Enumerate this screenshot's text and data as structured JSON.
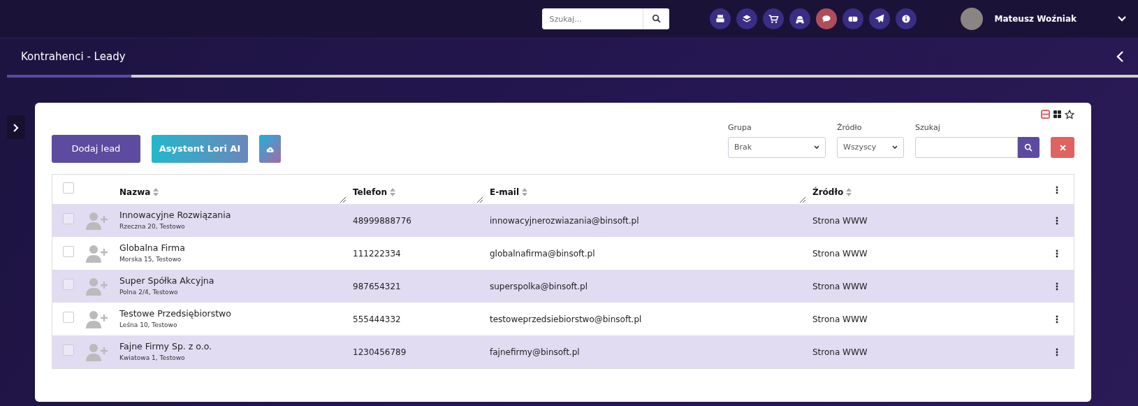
{
  "topbar": {
    "search": {
      "placeholder": "Szukaj..."
    },
    "icons": [
      {
        "kind": "register",
        "highlighted": false
      },
      {
        "kind": "layers",
        "highlighted": false
      },
      {
        "kind": "cart",
        "highlighted": false
      },
      {
        "kind": "robot",
        "highlighted": false
      },
      {
        "kind": "chat",
        "highlighted": true
      },
      {
        "kind": "mailbox",
        "highlighted": false
      },
      {
        "kind": "plane",
        "highlighted": false
      },
      {
        "kind": "info",
        "highlighted": false
      }
    ],
    "user": {
      "name": "Mateusz Woźniak"
    }
  },
  "page": {
    "title": "Kontrahenci - Leady",
    "progress": {
      "level": 0.11
    }
  },
  "toolbar": {
    "buttons": [
      {
        "kind": "primary",
        "label": "Dodaj lead"
      },
      {
        "kind": "gradient",
        "label": "Asystent Lori AI"
      },
      {
        "kind": "cloud"
      }
    ],
    "view_toggles": [
      {
        "kind": "list",
        "selected": true
      },
      {
        "kind": "grid",
        "selected": false
      },
      {
        "kind": "star",
        "selected": false
      }
    ],
    "filters": [
      {
        "kind": "select",
        "label": "Grupa",
        "value": "Brak"
      },
      {
        "kind": "select",
        "label": "Źródło",
        "value": "Wszyscy"
      },
      {
        "kind": "search",
        "label": "Szukaj"
      }
    ]
  },
  "table": {
    "header_checked": false,
    "columns": [
      "Nazwa",
      "Telefon",
      "E-mail",
      "Źródło"
    ],
    "rows": [
      {
        "checked": false,
        "name": "Innowacyjne Rozwiązania",
        "address": "Rzeczna 20, Testowo",
        "phone": "48999888776",
        "email": "innowacyjnerozwiazania@binsoft.pl",
        "source": "Strona WWW"
      },
      {
        "checked": false,
        "name": "Globalna Firma",
        "address": "Morska 15, Testowo",
        "phone": "111222334",
        "email": "globalnafirma@binsoft.pl",
        "source": "Strona WWW"
      },
      {
        "checked": false,
        "name": "Super Spółka Akcyjna",
        "address": "Polna 2/4, Testowo",
        "phone": "987654321",
        "email": "superspolka@binsoft.pl",
        "source": "Strona WWW"
      },
      {
        "checked": false,
        "name": "Testowe Przedsiębiorstwo",
        "address": "Leśna 10, Testowo",
        "phone": "555444332",
        "email": "testoweprzedsiebiorstwo@binsoft.pl",
        "source": "Strona WWW"
      },
      {
        "checked": false,
        "name": "Fajne Firmy Sp. z o.o.",
        "address": "Kwiatowa 1, Testowo",
        "phone": "1230456789",
        "email": "fajnefirmy@binsoft.pl",
        "source": "Strona WWW"
      }
    ]
  }
}
